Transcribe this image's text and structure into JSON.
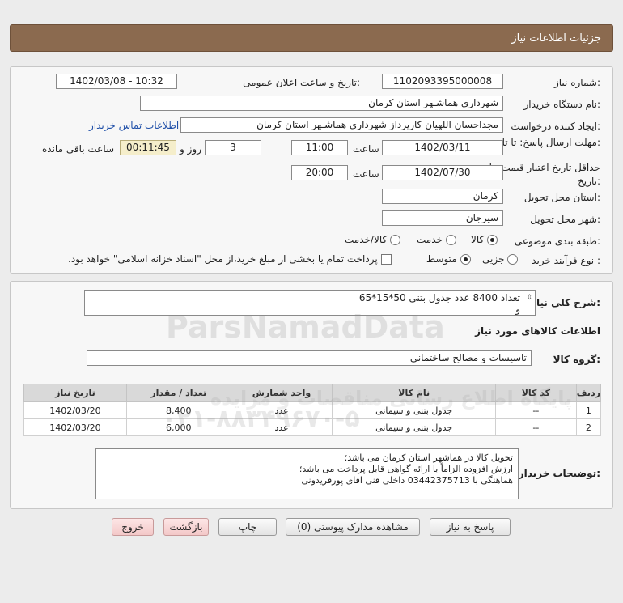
{
  "header": {
    "title": "جزئیات اطلاعات نیاز"
  },
  "form": {
    "need_number_label": "شماره نیاز:",
    "need_number": "1102093395000008",
    "announce_label": "تاریخ و ساعت اعلان عمومی:",
    "announce_value": "1402/03/08 - 10:32",
    "buyer_label": "نام دستگاه خریدار:",
    "buyer_value": "شهرداری هماشـهر استان کرمان",
    "creator_label": "ایجاد کننده درخواست:",
    "creator_value": "مجداحسان اللهیان کارپرداز  شهرداری هماشـهر استان کرمان",
    "contact_link": "اطلاعات تماس خریدار",
    "deadline_label": "مهلت ارسال پاسخ: تا تاریخ:",
    "deadline_date": "1402/03/11",
    "time_label": "ساعت",
    "deadline_time": "11:00",
    "days_value": "3",
    "days_label": "روز و",
    "remaining_value": "00:11:45",
    "remaining_label": "ساعت باقی مانده",
    "validity_label": "حداقل تاریخ اعتبار قیمت: تا تاریخ:",
    "validity_date": "1402/07/30",
    "validity_time": "20:00",
    "province_label": "استان محل تحویل:",
    "province_value": "کرمان",
    "city_label": "شهر محل تحویل:",
    "city_value": "سیرجان",
    "category_label": "طبقه بندی موضوعی:",
    "category_options": [
      "کالا",
      "خدمت",
      "کالا/خدمت"
    ],
    "category_selected": "کالا",
    "process_label": "نوع فرآیند خرید :",
    "process_options": [
      "جزیی",
      "متوسط"
    ],
    "process_selected": "متوسط",
    "treasury_note": "پرداخت تمام یا بخشی از مبلغ خرید،از محل \"اسناد خزانه اسلامی\" خواهد بود."
  },
  "description": {
    "label": "شرح کلی نیاز:",
    "line1": "تعداد 8400 عدد جدول بتنی 50*15*65",
    "line2": "و"
  },
  "goods": {
    "section_title": "اطلاعات کالاهای مورد نیاز",
    "group_label": "گروه کالا:",
    "group_value": "تاسیسات و مصالح ساختمانی",
    "columns": [
      "ردیف",
      "کد کالا",
      "نام کالا",
      "واحد شمارش",
      "تعداد / مقدار",
      "تاریخ نیاز"
    ],
    "rows": [
      [
        "1",
        "--",
        "جدول بتنی و سیمانی",
        "عدد",
        "8,400",
        "1402/03/20"
      ],
      [
        "2",
        "--",
        "جدول بتنی و سیمانی",
        "عدد",
        "6,000",
        "1402/03/20"
      ]
    ]
  },
  "buyer_notes": {
    "label": "توضیحات خریدار:",
    "line1": "تحویل کالا در هماشهر استان کرمان می باشد؛",
    "line2": "ارزش افزوده الزاماً با ارائه گواهی قابل پرداخت می باشد؛",
    "line3": "هماهنگی با 03442375713 داخلی فنی اقای پورفریدونی"
  },
  "buttons": {
    "reply": "پاسخ به نیاز",
    "attachments": "مشاهده مدارک پیوستی (0)",
    "print": "چاپ",
    "back": "بازگشت",
    "exit": "خروج"
  },
  "watermark": {
    "text1": "ParsNamadData",
    "text2": "پایگاه اطلاع رسانی مناقصات و مزایده",
    "text3": "۰۲۱-۸۸۳۴۹۶۷۰-۵"
  }
}
